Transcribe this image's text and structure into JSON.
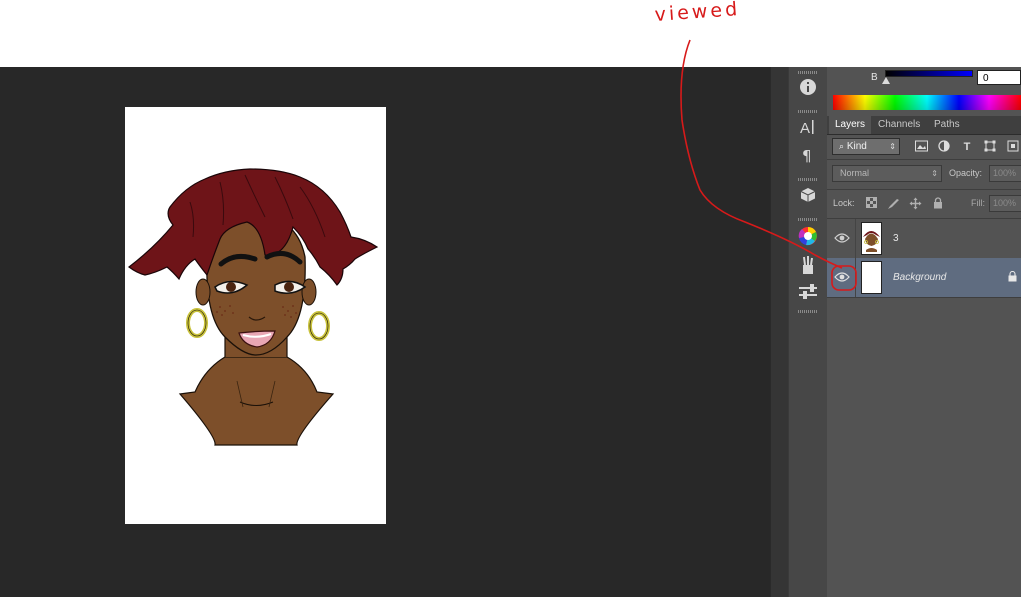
{
  "annotation": {
    "text": "viewed",
    "color": "#d71a1a"
  },
  "toolbar_icons": [
    "info-icon",
    "character-icon",
    "paragraph-icon",
    "3d-cube-icon",
    "color-wheel-icon",
    "brushes-icon",
    "adjustments-icon"
  ],
  "color_panel": {
    "channel_label": "B",
    "channel_value": "0"
  },
  "layers_panel": {
    "tabs": [
      {
        "label": "Layers",
        "active": true
      },
      {
        "label": "Channels",
        "active": false
      },
      {
        "label": "Paths",
        "active": false
      }
    ],
    "filter": {
      "kind_label": "Kind",
      "icons": [
        "image-filter-icon",
        "adjustment-filter-icon",
        "type-filter-icon",
        "shape-filter-icon",
        "smart-object-filter-icon"
      ]
    },
    "blend_mode": "Normal",
    "opacity_label": "Opacity:",
    "opacity_value": "100%",
    "lock_label": "Lock:",
    "fill_label": "Fill:",
    "fill_value": "100%",
    "layers": [
      {
        "name": "3",
        "visible": true,
        "selected": false
      },
      {
        "name": "Background",
        "visible": true,
        "selected": true,
        "locked": true
      }
    ]
  },
  "colors": {
    "workspace": "#282828",
    "panel": "#535353",
    "selected_layer": "#5f6c80",
    "hair": "#6e1418",
    "skin": "#7d4f2a",
    "earring": "#c8c23c"
  }
}
